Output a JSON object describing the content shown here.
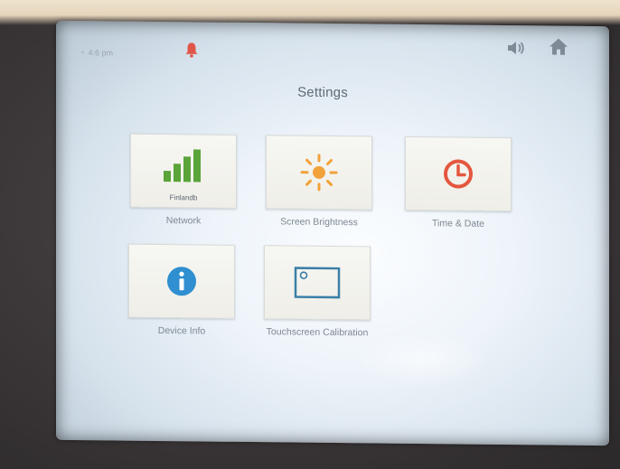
{
  "status": {
    "time": "4:6 pm",
    "time_icon": "clock-small-icon",
    "bell_icon": "bell-icon",
    "bell_color": "#e0574a",
    "speaker_icon": "speaker-icon",
    "home_icon": "home-icon"
  },
  "page": {
    "title": "Settings"
  },
  "tiles": [
    {
      "label": "Network",
      "sublabel": "Finlandb",
      "icon": "signal-bars-icon",
      "color": "#5aa43a"
    },
    {
      "label": "Screen Brightness",
      "icon": "sun-icon",
      "color": "#f2a23a"
    },
    {
      "label": "Time & Date",
      "icon": "clock-icon",
      "color": "#e4573f"
    },
    {
      "label": "Device Info",
      "icon": "info-icon",
      "color": "#2f8fd0"
    },
    {
      "label": "Touchscreen Calibration",
      "icon": "screen-calibration-icon",
      "color": "#3a7fa8"
    }
  ]
}
